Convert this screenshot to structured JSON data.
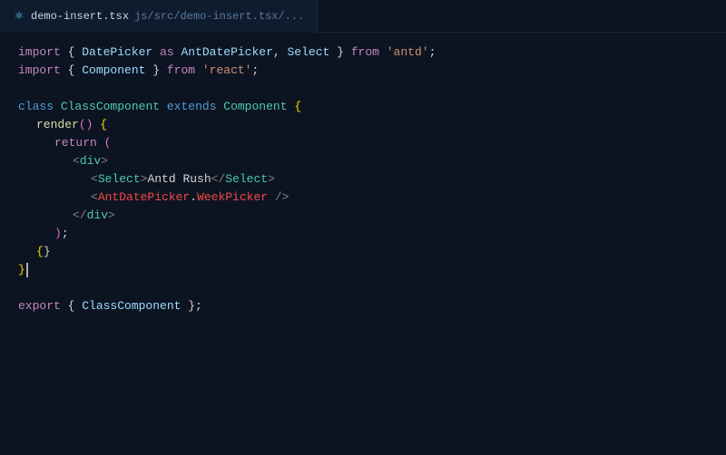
{
  "tab": {
    "filename": "demo-insert.tsx",
    "path": "js/src/demo-insert.tsx/..."
  },
  "code": {
    "lines": [
      "import { DatePicker as AntDatePicker, Select } from 'antd';",
      "import { Component } from 'react';",
      "",
      "class ClassComponent extends Component {",
      "  render() {",
      "    return (",
      "      <div>",
      "        <Select>Antd Rush</Select>",
      "        <AntDatePicker.WeekPicker />",
      "      </div>",
      "    );",
      "  }",
      "}",
      "",
      "export { ClassComponent };"
    ]
  }
}
